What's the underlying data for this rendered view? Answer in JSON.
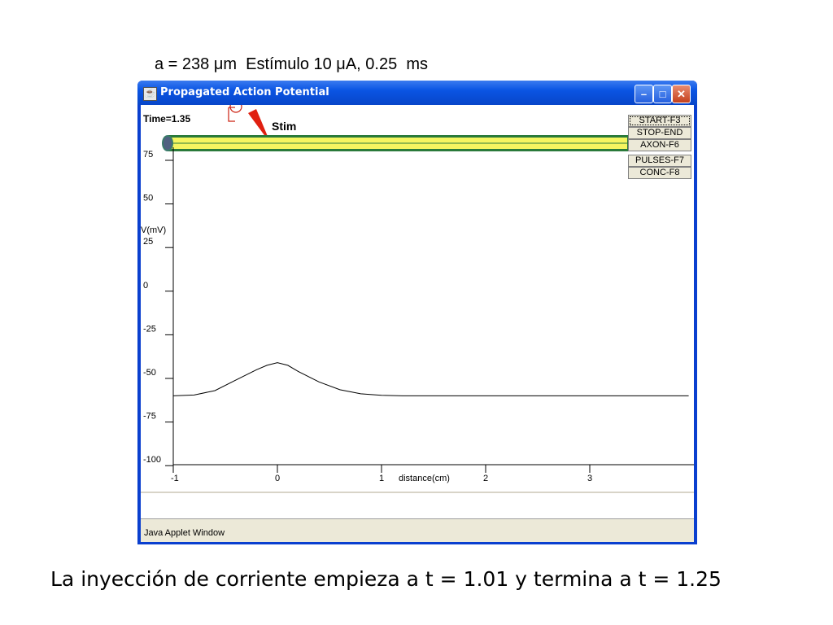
{
  "slide": {
    "top_caption": "a = 238 μm  Estímulo 10 μA, 0.25  ms",
    "bottom_caption": "La inyección de corriente empieza a t = 1.01 y termina a t = 1.25"
  },
  "window": {
    "title": "Propagated Action Potential",
    "icon": "java-cup-icon",
    "minimize_icon": "minimize-icon",
    "maximize_icon": "maximize-icon",
    "close_icon": "close-icon",
    "status": "Java Applet Window"
  },
  "applet": {
    "time_label": "Time=1.35",
    "stim_label": "Stim",
    "buttons": {
      "start": "START-F3",
      "stop": "STOP-END",
      "axon": "AXON-F6",
      "pulses": "PULSES-F7",
      "conc": "CONC-F8"
    },
    "colors": {
      "axon": "#f5f560",
      "axon_edge": "#2a7a3a",
      "stim_arrow": "#e02010",
      "electrode": "#cc2010",
      "title_bar": "#0a54e3"
    }
  },
  "chart_data": {
    "type": "line",
    "title": "",
    "xlabel": "distance(cm)",
    "ylabel": "V(mV)",
    "xlim": [
      -1,
      4
    ],
    "ylim": [
      -100,
      75
    ],
    "x_ticks": [
      -1,
      0,
      1,
      2,
      3
    ],
    "x_tick_labels": [
      "-1",
      "0",
      "1",
      "2",
      "3"
    ],
    "y_ticks": [
      75,
      50,
      25,
      0,
      -25,
      -50,
      -75,
      -100
    ],
    "y_tick_labels": [
      "75",
      "50",
      "25",
      "0",
      "-25",
      "-50",
      "-75",
      "-100"
    ],
    "grid": false,
    "series": [
      {
        "x": [
          -1,
          -0.8,
          -0.6,
          -0.4,
          -0.2,
          -0.1,
          0,
          0.1,
          0.2,
          0.4,
          0.6,
          0.8,
          1.0,
          1.2,
          1.5,
          2,
          2.5,
          3,
          3.5,
          3.95
        ],
        "y": [
          -60,
          -59.5,
          -57,
          -51,
          -45,
          -42.5,
          -41,
          -42.5,
          -46,
          -52,
          -56.5,
          -58.8,
          -59.7,
          -60,
          -60,
          -60,
          -60,
          -60,
          -60,
          -60
        ]
      }
    ]
  }
}
